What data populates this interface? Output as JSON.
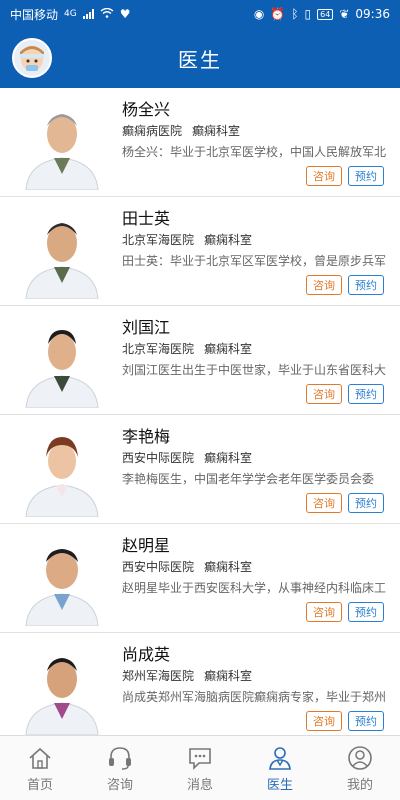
{
  "status": {
    "carrier": "中国移动",
    "net": "4G",
    "battery": "64",
    "time": "09:36"
  },
  "header": {
    "title": "医生"
  },
  "doctors": [
    {
      "name": "杨全兴",
      "hospital": "癫痫病医院",
      "dept": "癫痫科室",
      "desc": "杨全兴：毕业于北京军医学校，中国人民解放军北",
      "consult": "咨询",
      "book": "预约"
    },
    {
      "name": "田士英",
      "hospital": "北京军海医院",
      "dept": "癫痫科室",
      "desc": "田士英：毕业于北京军区军医学校，曾是原步兵军",
      "consult": "咨询",
      "book": "预约"
    },
    {
      "name": "刘国江",
      "hospital": "北京军海医院",
      "dept": "癫痫科室",
      "desc": "刘国江医生出生于中医世家，毕业于山东省医科大",
      "consult": "咨询",
      "book": "预约"
    },
    {
      "name": "李艳梅",
      "hospital": "西安中际医院",
      "dept": "癫痫科室",
      "desc": "李艳梅医生，中国老年学学会老年医学委员会委",
      "consult": "咨询",
      "book": "预约"
    },
    {
      "name": "赵明星",
      "hospital": "西安中际医院",
      "dept": "癫痫科室",
      "desc": "赵明星毕业于西安医科大学，从事神经内科临床工",
      "consult": "咨询",
      "book": "预约"
    },
    {
      "name": "尚成英",
      "hospital": "郑州军海医院",
      "dept": "癫痫科室",
      "desc": "尚成英郑州军海脑病医院癫痫病专家，毕业于郑州",
      "consult": "咨询",
      "book": "预约"
    }
  ],
  "tabs": [
    {
      "label": "首页",
      "icon": "home-icon"
    },
    {
      "label": "咨询",
      "icon": "headset-icon"
    },
    {
      "label": "消息",
      "icon": "message-icon"
    },
    {
      "label": "医生",
      "icon": "doctor-icon"
    },
    {
      "label": "我的",
      "icon": "user-icon"
    }
  ],
  "colors": {
    "primary": "#0d5fb3",
    "consult": "#e07a2a",
    "book": "#2a7fd0",
    "tab_active": "#2a6db5"
  }
}
